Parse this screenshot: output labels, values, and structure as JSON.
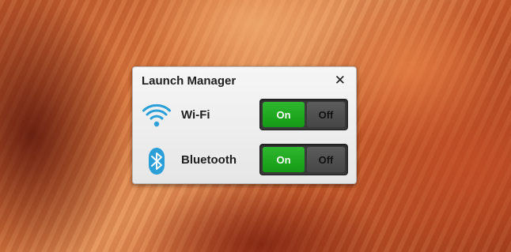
{
  "dialog": {
    "title": "Launch Manager",
    "close_glyph": "✕"
  },
  "rows": [
    {
      "label": "Wi-Fi",
      "icon": "wifi-icon",
      "on_label": "On",
      "off_label": "Off",
      "state": "on"
    },
    {
      "label": "Bluetooth",
      "icon": "bluetooth-icon",
      "on_label": "On",
      "off_label": "Off",
      "state": "on"
    }
  ],
  "colors": {
    "toggle_on": "#1aa81a",
    "icon_blue": "#2a9fd8"
  }
}
